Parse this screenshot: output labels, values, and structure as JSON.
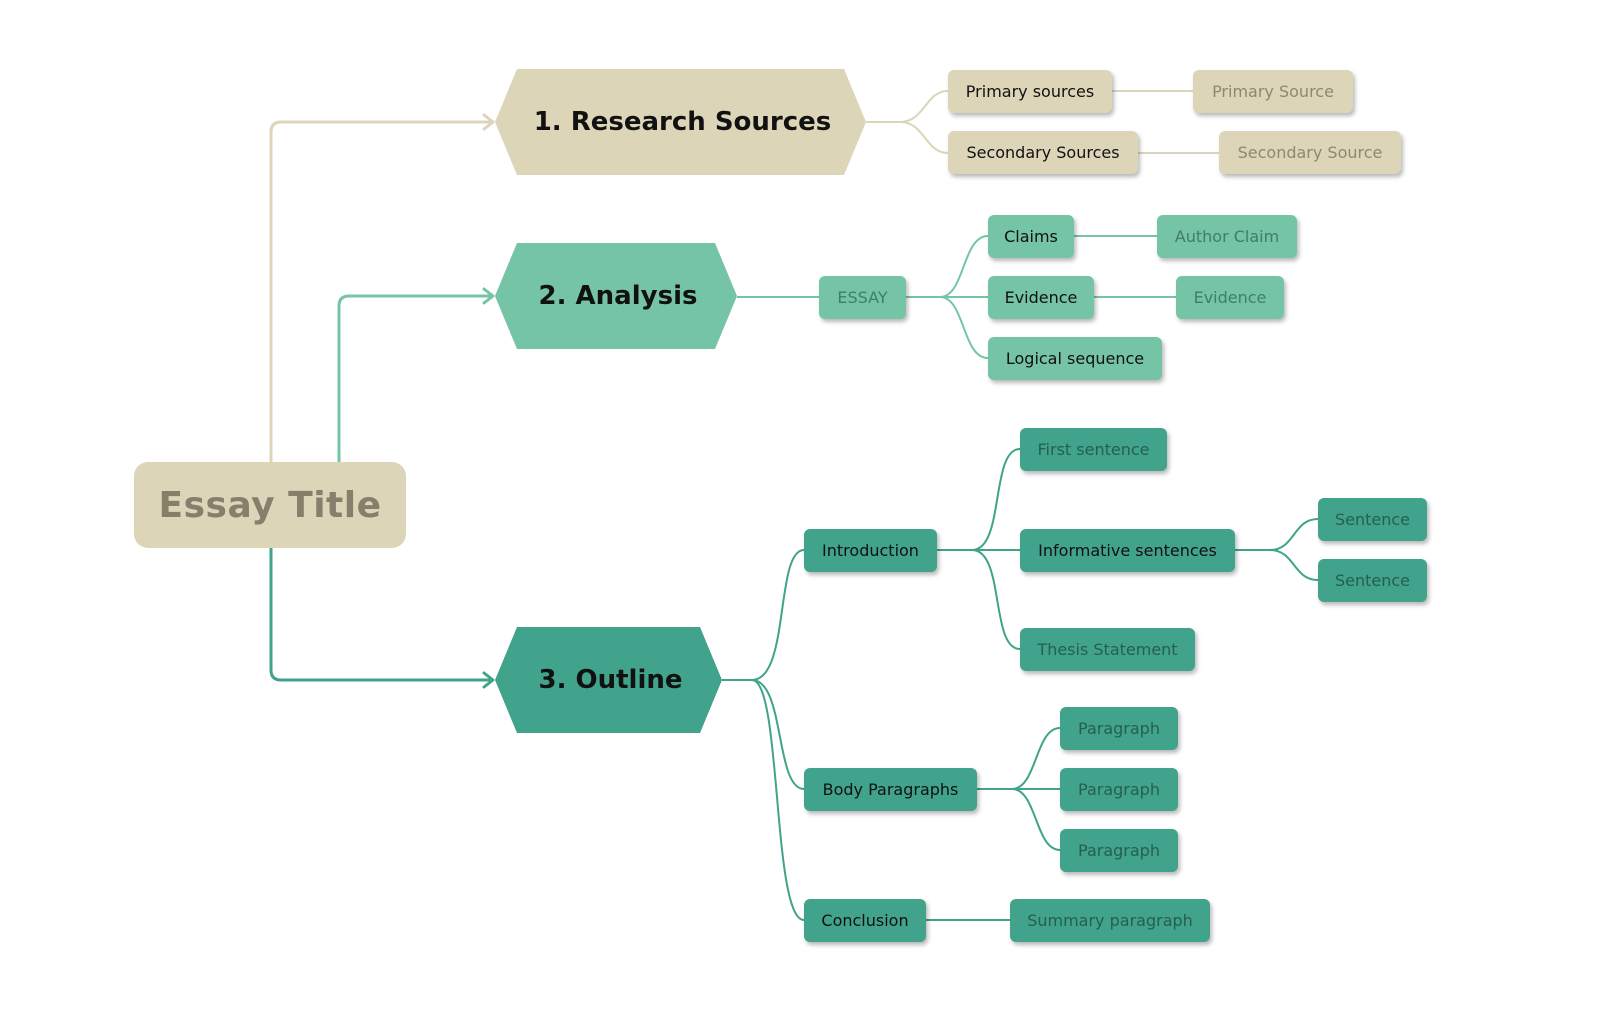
{
  "root": {
    "label": "Essay Title"
  },
  "colors": {
    "tan": "#dcd5b8",
    "tan_line": "#dcd5b8",
    "mint": "#75c4a5",
    "teal": "#41a38b",
    "root_text": "#857f6c"
  },
  "branches": [
    {
      "label": "1. Research Sources",
      "children": [
        {
          "label": "Primary sources",
          "children": [
            {
              "label": "Primary Source"
            }
          ]
        },
        {
          "label": "Secondary Sources",
          "children": [
            {
              "label": "Secondary Source"
            }
          ]
        }
      ]
    },
    {
      "label": "2. Analysis",
      "children": [
        {
          "label": "ESSAY",
          "children": [
            {
              "label": "Claims",
              "children": [
                {
                  "label": "Author Claim"
                }
              ]
            },
            {
              "label": "Evidence",
              "children": [
                {
                  "label": "Evidence"
                }
              ]
            },
            {
              "label": "Logical sequence"
            }
          ]
        }
      ]
    },
    {
      "label": "3. Outline",
      "children": [
        {
          "label": "Introduction",
          "children": [
            {
              "label": "First sentence"
            },
            {
              "label": "Informative sentences",
              "children": [
                {
                  "label": "Sentence"
                },
                {
                  "label": "Sentence"
                }
              ]
            },
            {
              "label": "Thesis Statement"
            }
          ]
        },
        {
          "label": "Body Paragraphs",
          "children": [
            {
              "label": "Paragraph"
            },
            {
              "label": "Paragraph"
            },
            {
              "label": "Paragraph"
            }
          ]
        },
        {
          "label": "Conclusion",
          "children": [
            {
              "label": "Summary paragraph"
            }
          ]
        }
      ]
    }
  ]
}
